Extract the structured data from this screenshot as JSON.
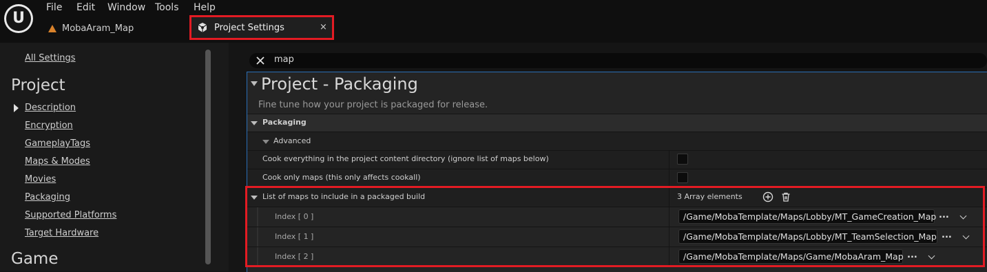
{
  "menu": [
    "File",
    "Edit",
    "Window",
    "Tools",
    "Help"
  ],
  "tabs": {
    "map_tab": "MobaAram_Map",
    "settings_tab": "Project Settings",
    "close_glyph": "×"
  },
  "logo_glyph": "U",
  "sidebar": {
    "all_settings": "All Settings",
    "category_project": "Project",
    "items": [
      "Description",
      "Encryption",
      "GameplayTags",
      "Maps & Modes",
      "Movies",
      "Packaging",
      "Supported Platforms",
      "Target Hardware"
    ],
    "category_game": "Game"
  },
  "search": {
    "value": "map"
  },
  "section": {
    "title": "Project - Packaging",
    "description": "Fine tune how your project is packaged for release."
  },
  "packaging": {
    "header": "Packaging",
    "advanced": "Advanced",
    "cook_everything": "Cook everything in the project content directory (ignore list of maps below)",
    "cook_only_maps": "Cook only maps (this only affects cookall)",
    "maps_list_label": "List of maps to include in a packaged build",
    "array_count": "3 Array elements",
    "entries": [
      {
        "index": "Index [ 0 ]",
        "path": "/Game/MobaTemplate/Maps/Lobby/MT_GameCreation_Map"
      },
      {
        "index": "Index [ 1 ]",
        "path": "/Game/MobaTemplate/Maps/Lobby/MT_TeamSelection_Map"
      },
      {
        "index": "Index [ 2 ]",
        "path": "/Game/MobaTemplate/Maps/Game/MobaAram_Map"
      }
    ],
    "more_glyph": "..."
  },
  "colors": {
    "highlight": "#e31b23",
    "accent": "#2a6fb8",
    "map_icon": "#d9822b"
  }
}
